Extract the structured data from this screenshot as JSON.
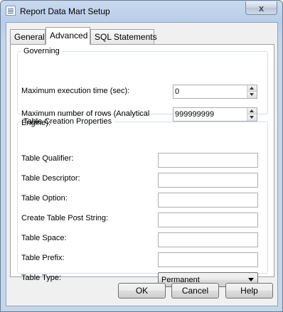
{
  "window": {
    "title": "Report Data Mart Setup",
    "close_symbol": "x",
    "app_icon": "report-icon"
  },
  "tabs": [
    {
      "label": "General",
      "active": false
    },
    {
      "label": "Advanced",
      "active": true
    },
    {
      "label": "SQL Statements",
      "active": false
    }
  ],
  "governing": {
    "legend": "Governing",
    "max_exec_time": {
      "label": "Maximum execution time (sec):",
      "value": "0"
    },
    "max_rows": {
      "label": "Maximum number of rows (Analytical Engine):",
      "value": "999999999"
    }
  },
  "table_creation": {
    "legend": "Table Creation Properties",
    "fields": [
      {
        "label": "Table Qualifier:",
        "value": ""
      },
      {
        "label": "Table Descriptor:",
        "value": ""
      },
      {
        "label": "Table Option:",
        "value": ""
      },
      {
        "label": "Create Table Post String:",
        "value": ""
      },
      {
        "label": "Table Space:",
        "value": ""
      },
      {
        "label": "Table Prefix:",
        "value": ""
      }
    ],
    "table_type": {
      "label": "Table Type:",
      "value": "Permanent"
    }
  },
  "buttons": {
    "ok": "OK",
    "cancel": "Cancel",
    "help": "Help"
  }
}
